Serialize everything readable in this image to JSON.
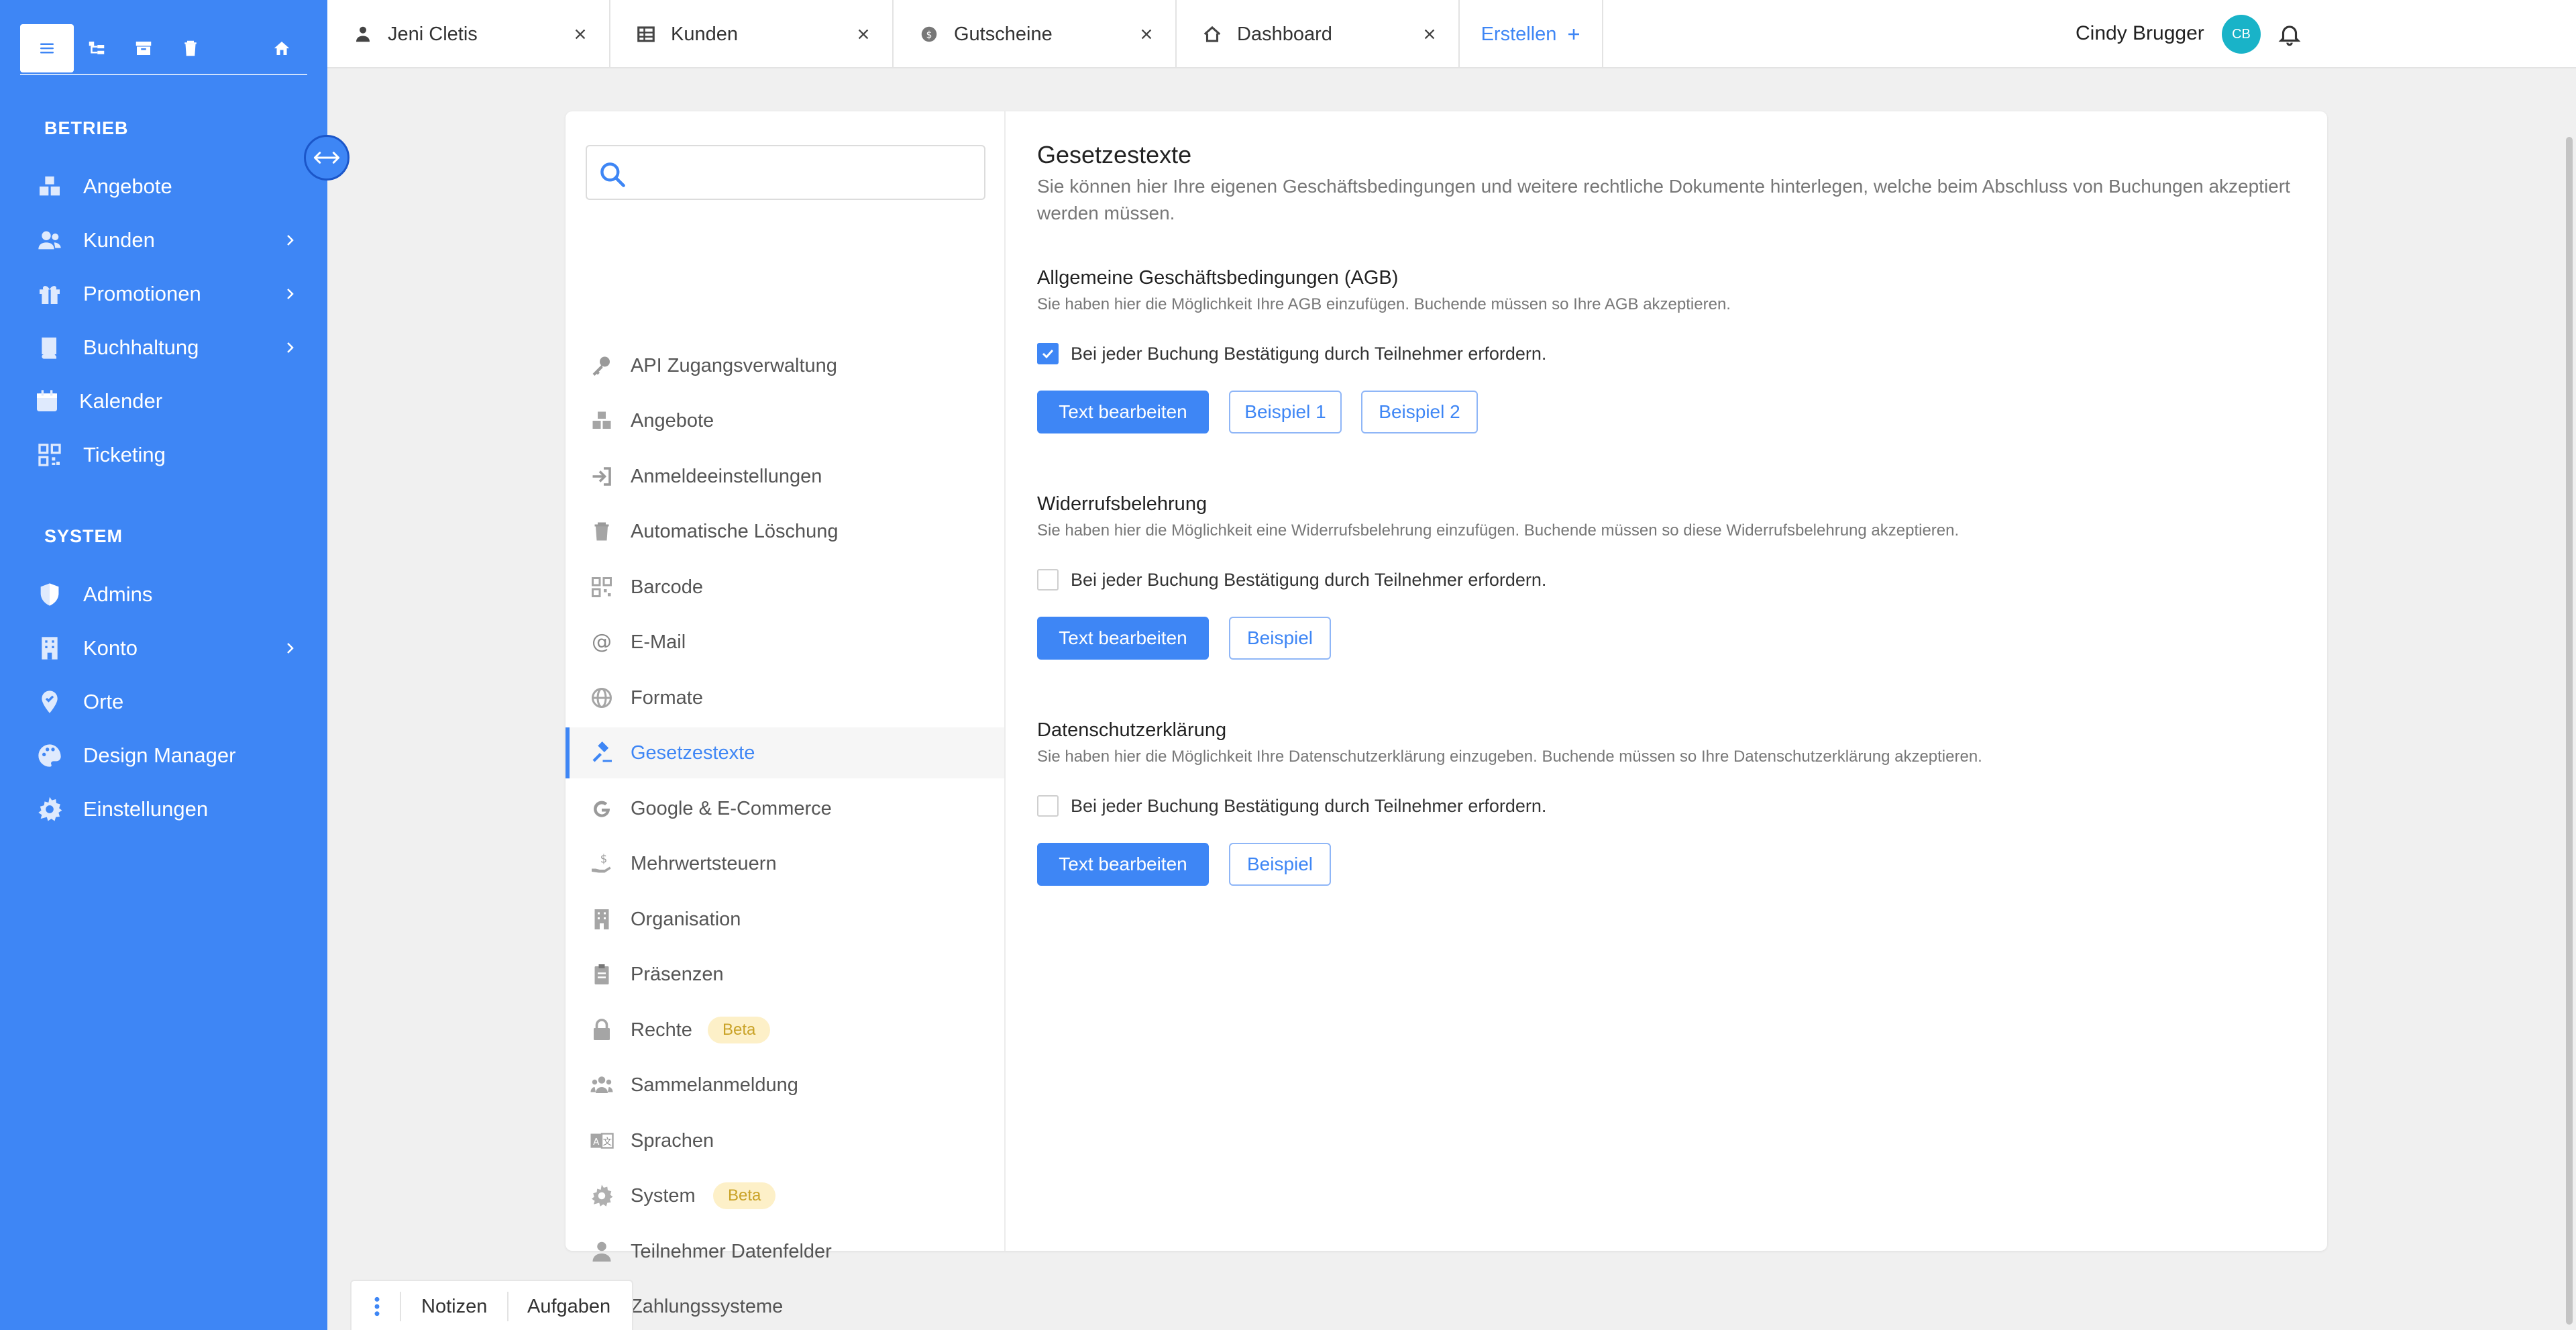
{
  "sidebar": {
    "section_betrieb": "BETRIEB",
    "section_system": "SYSTEM",
    "betrieb_items": [
      {
        "label": "Angebote"
      },
      {
        "label": "Kunden"
      },
      {
        "label": "Promotionen"
      },
      {
        "label": "Buchhaltung"
      },
      {
        "label": "Kalender"
      },
      {
        "label": "Ticketing"
      }
    ],
    "system_items": [
      {
        "label": "Admins"
      },
      {
        "label": "Konto"
      },
      {
        "label": "Orte"
      },
      {
        "label": "Design Manager"
      },
      {
        "label": "Einstellungen"
      }
    ]
  },
  "tabs": [
    {
      "label": "Jeni Cletis",
      "icon": "person-icon"
    },
    {
      "label": "Kunden",
      "icon": "table-icon"
    },
    {
      "label": "Gutscheine",
      "icon": "coin-icon"
    },
    {
      "label": "Dashboard",
      "icon": "dashboard-icon"
    }
  ],
  "create_tab": {
    "label": "Erstellen"
  },
  "user": {
    "name": "Cindy Brugger",
    "initials": "CB"
  },
  "settings_nav": {
    "search_value": "",
    "items": [
      {
        "label": "API Zugangsverwaltung"
      },
      {
        "label": "Angebote"
      },
      {
        "label": "Anmeldeeinstellungen"
      },
      {
        "label": "Automatische Löschung"
      },
      {
        "label": "Barcode"
      },
      {
        "label": "E-Mail"
      },
      {
        "label": "Formate"
      },
      {
        "label": "Gesetzestexte"
      },
      {
        "label": "Google & E-Commerce"
      },
      {
        "label": "Mehrwertsteuern"
      },
      {
        "label": "Organisation"
      },
      {
        "label": "Präsenzen"
      },
      {
        "label": "Rechte",
        "badge": "Beta"
      },
      {
        "label": "Sammelanmeldung"
      },
      {
        "label": "Sprachen"
      },
      {
        "label": "System",
        "badge": "Beta"
      },
      {
        "label": "Teilnehmer Datenfelder"
      },
      {
        "label": "Zahlungssysteme"
      }
    ]
  },
  "content": {
    "title": "Gesetzestexte",
    "description": "Sie können hier Ihre eigenen Geschäftsbedingungen und weitere rechtliche Dokumente hinterlegen, welche beim Abschluss von Buchungen akzeptiert werden müssen.",
    "sections": [
      {
        "title": "Allgemeine Geschäftsbedingungen (AGB)",
        "description": "Sie haben hier die Möglichkeit Ihre AGB einzufügen. Buchende müssen so Ihre AGB akzeptieren.",
        "checkbox_label": "Bei jeder Buchung Bestätigung durch Teilnehmer erfordern.",
        "checked": true,
        "edit_label": "Text bearbeiten",
        "example_labels": [
          "Beispiel 1",
          "Beispiel 2"
        ]
      },
      {
        "title": "Widerrufsbelehrung",
        "description": "Sie haben hier die Möglichkeit eine Widerrufsbelehrung einzufügen. Buchende müssen so diese Widerrufsbelehrung akzeptieren.",
        "checkbox_label": "Bei jeder Buchung Bestätigung durch Teilnehmer erfordern.",
        "checked": false,
        "edit_label": "Text bearbeiten",
        "example_labels": [
          "Beispiel"
        ]
      },
      {
        "title": "Datenschutzerklärung",
        "description": "Sie haben hier die Möglichkeit Ihre Datenschutzerklärung einzugeben. Buchende müssen so Ihre Datenschutzerklärung akzeptieren.",
        "checkbox_label": "Bei jeder Buchung Bestätigung durch Teilnehmer erfordern.",
        "checked": false,
        "edit_label": "Text bearbeiten",
        "example_labels": [
          "Beispiel"
        ]
      }
    ]
  },
  "bottom_bar": {
    "notes_label": "Notizen",
    "tasks_label": "Aufgaben"
  },
  "colors": {
    "accent": "#3e86f5",
    "avatar": "#19b3c8",
    "beta_bg": "#fdf0c8",
    "beta_text": "#c9a227"
  }
}
